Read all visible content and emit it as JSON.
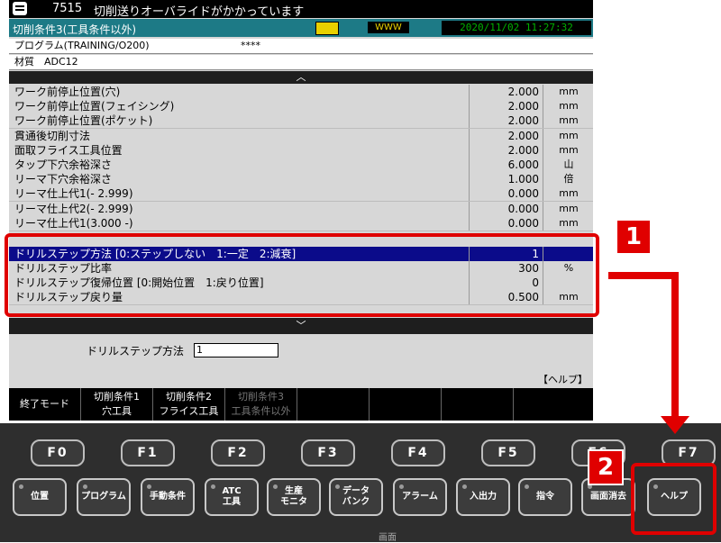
{
  "topbar": {
    "code": "7515",
    "message": "切削送りオーバライドがかかっています"
  },
  "status": {
    "title": "切削条件3(工具条件以外)",
    "datetime": "2020/11/02 11:27:32",
    "indicator2": "WWW"
  },
  "program": {
    "label": "プログラム(TRAINING/O200)",
    "value": "****"
  },
  "material": {
    "label": "材質　ADC12"
  },
  "arrows": {
    "up": "︿",
    "down": "﹀"
  },
  "rows": [
    {
      "name": "ワーク前停止位置(穴)",
      "value": "2.000",
      "unit": "mm"
    },
    {
      "name": "ワーク前停止位置(フェイシング)",
      "value": "2.000",
      "unit": "mm"
    },
    {
      "name": "ワーク前停止位置(ポケット)",
      "value": "2.000",
      "unit": "mm"
    },
    {
      "name": "貫通後切削寸法",
      "value": "2.000",
      "unit": "mm"
    },
    {
      "name": "面取フライス工具位置",
      "value": "2.000",
      "unit": "mm"
    },
    {
      "name": "タップ下穴余裕深さ",
      "value": "6.000",
      "unit": "山"
    },
    {
      "name": "リーマ下穴余裕深さ",
      "value": "1.000",
      "unit": "倍"
    },
    {
      "name": "リーマ仕上代1(- 2.999)",
      "value": "0.000",
      "unit": "mm"
    },
    {
      "name": "リーマ仕上代2(- 2.999)",
      "value": "0.000",
      "unit": "mm"
    },
    {
      "name": "リーマ仕上代1(3.000 -)",
      "value": "0.000",
      "unit": "mm"
    }
  ],
  "drill_rows": [
    {
      "name": "ドリルステップ方法 [0:ステップしない　1:一定　2:減衰]",
      "value": "1",
      "unit": ""
    },
    {
      "name": "ドリルステップ比率",
      "value": "300",
      "unit": "%"
    },
    {
      "name": "ドリルステップ復帰位置 [0:開始位置　1:戻り位置]",
      "value": "0",
      "unit": ""
    },
    {
      "name": "ドリルステップ戻り量",
      "value": "0.500",
      "unit": "mm"
    }
  ],
  "input": {
    "label": "ドリルステップ方法",
    "value": "1",
    "help": "【ヘルプ】"
  },
  "softkeys": [
    {
      "l1": "終了モード",
      "l2": ""
    },
    {
      "l1": "切削条件1",
      "l2": "穴工具"
    },
    {
      "l1": "切削条件2",
      "l2": "フライス工具"
    },
    {
      "l1": "切削条件3",
      "l2": "工具条件以外"
    }
  ],
  "fkeys": [
    "F0",
    "F1",
    "F2",
    "F3",
    "F4",
    "F5",
    "F6",
    "F7"
  ],
  "hkeys": [
    "位置",
    "プログラム",
    "手動条件",
    "ATC\n工具",
    "生産\nモニタ",
    "データ\nバンク",
    "アラーム",
    "入出力",
    "指令",
    "画面消去",
    "ヘルプ"
  ],
  "badges": [
    "1",
    "2"
  ],
  "bottom_label": "画面"
}
